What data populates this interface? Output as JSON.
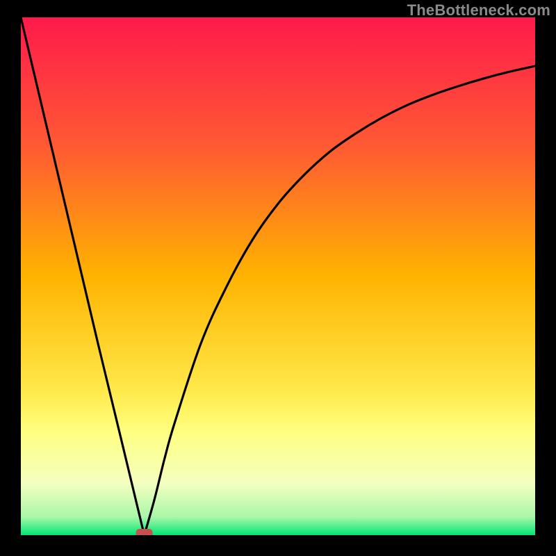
{
  "watermark": "TheBottleneck.com",
  "chart_data": {
    "type": "line",
    "title": "",
    "xlabel": "",
    "ylabel": "",
    "xlim": [
      0,
      100
    ],
    "ylim": [
      0,
      100
    ],
    "grid": false,
    "legend": false,
    "minimum_marker": {
      "x": 24,
      "y": 0,
      "color": "#c94f4f"
    },
    "gradient_stops": [
      {
        "pos": 0.0,
        "color": "#ff1a4b"
      },
      {
        "pos": 0.25,
        "color": "#ff5a33"
      },
      {
        "pos": 0.5,
        "color": "#ffb300"
      },
      {
        "pos": 0.72,
        "color": "#ffe94a"
      },
      {
        "pos": 0.8,
        "color": "#ffff80"
      },
      {
        "pos": 0.9,
        "color": "#f4ffc0"
      },
      {
        "pos": 0.965,
        "color": "#a8f7a8"
      },
      {
        "pos": 1.0,
        "color": "#00e676"
      }
    ],
    "series": [
      {
        "name": "bottleneck-curve",
        "x": [
          0,
          5,
          10,
          15,
          20,
          24,
          26,
          28,
          30,
          35,
          40,
          45,
          50,
          55,
          60,
          65,
          70,
          75,
          80,
          85,
          90,
          95,
          100
        ],
        "values": [
          100,
          79,
          58,
          37,
          16.5,
          0,
          7,
          15,
          22,
          37,
          48,
          57,
          64,
          69.5,
          74,
          77.5,
          80.5,
          83,
          85,
          86.7,
          88.2,
          89.5,
          90.6
        ]
      }
    ]
  }
}
